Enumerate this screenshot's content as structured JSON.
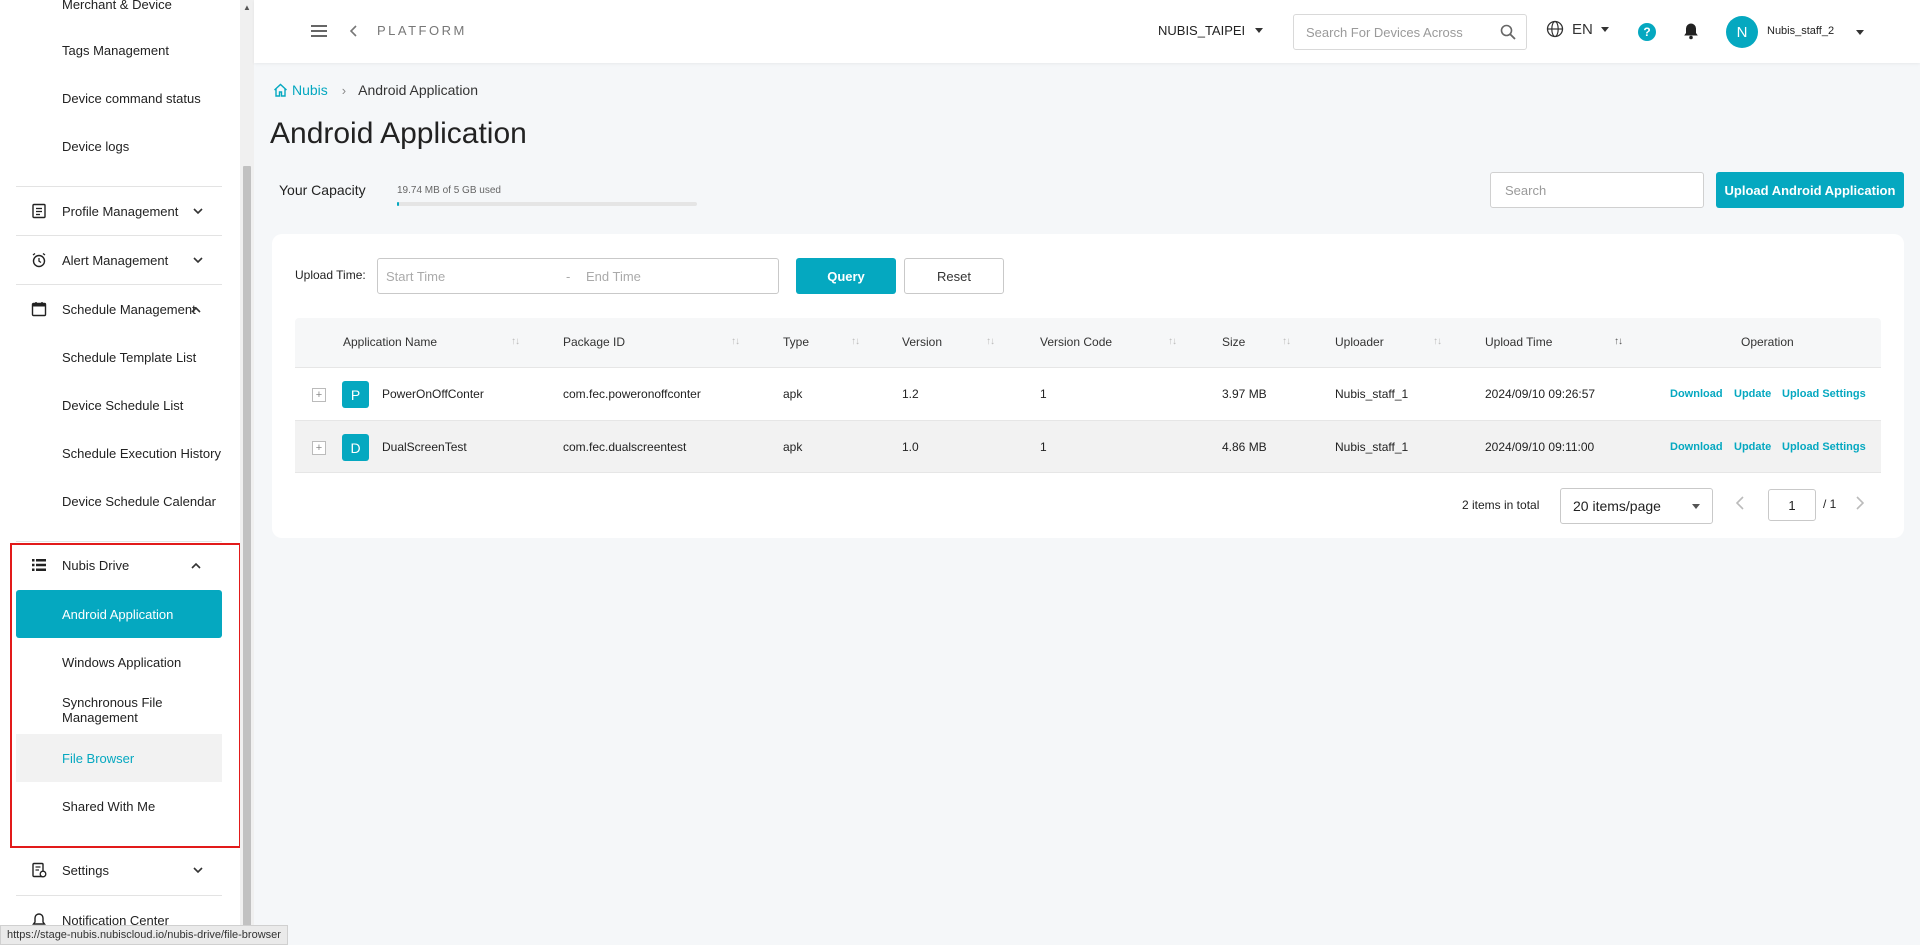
{
  "sidebar": {
    "items": [
      {
        "label": "Merchant & Device"
      },
      {
        "label": "Tags Management"
      },
      {
        "label": "Device command status"
      },
      {
        "label": "Device logs"
      },
      {
        "label": "Profile Management"
      },
      {
        "label": "Alert Management"
      },
      {
        "label": "Schedule Management"
      },
      {
        "label": "Schedule Template List"
      },
      {
        "label": "Device Schedule List"
      },
      {
        "label": "Schedule Execution History"
      },
      {
        "label": "Device Schedule Calendar"
      },
      {
        "label": "Nubis Drive"
      },
      {
        "label": "Android Application"
      },
      {
        "label": "Windows Application"
      },
      {
        "label": "Synchronous File Management"
      },
      {
        "label": "File Browser"
      },
      {
        "label": "Shared With Me"
      },
      {
        "label": "Settings"
      },
      {
        "label": "Notification Center"
      }
    ]
  },
  "topbar": {
    "platform": "PLATFORM",
    "tenant": "NUBIS_TAIPEI",
    "search_placeholder": "Search For Devices Across",
    "lang": "EN",
    "help": "?",
    "avatar_initial": "N",
    "username": "Nubis_staff_2"
  },
  "breadcrumb": {
    "home": "Nubis",
    "current": "Android Application"
  },
  "page": {
    "title": "Android Application",
    "capacity_label": "Your Capacity",
    "capacity_text": "19.74 MB of 5 GB used",
    "capacity_fraction": 0.004,
    "search_placeholder": "Search",
    "upload_button": "Upload Android Application"
  },
  "filter": {
    "label": "Upload Time:",
    "start_placeholder": "Start Time",
    "dash": "-",
    "end_placeholder": "End Time",
    "query": "Query",
    "reset": "Reset"
  },
  "table": {
    "columns": [
      "Application Name",
      "Package ID",
      "Type",
      "Version",
      "Version Code",
      "Size",
      "Uploader",
      "Upload Time",
      "Operation"
    ],
    "rows": [
      {
        "initial": "P",
        "name": "PowerOnOffConter",
        "package": "com.fec.poweronoffconter",
        "type": "apk",
        "version": "1.2",
        "version_code": "1",
        "size": "3.97 MB",
        "uploader": "Nubis_staff_1",
        "upload_time": "2024/09/10 09:26:57"
      },
      {
        "initial": "D",
        "name": "DualScreenTest",
        "package": "com.fec.dualscreentest",
        "type": "apk",
        "version": "1.0",
        "version_code": "1",
        "size": "4.86 MB",
        "uploader": "Nubis_staff_1",
        "upload_time": "2024/09/10 09:11:00"
      }
    ],
    "operations": [
      "Download",
      "Update",
      "Upload Settings"
    ]
  },
  "pagination": {
    "total": "2 items in total",
    "page_size": "20 items/page",
    "current_page": "1",
    "of_pages": "/ 1"
  },
  "statusbar": {
    "url": "https://stage-nubis.nubiscloud.io/nubis-drive/file-browser"
  },
  "colors": {
    "accent": "#05a8c0",
    "highlight": "#e21a1a"
  }
}
